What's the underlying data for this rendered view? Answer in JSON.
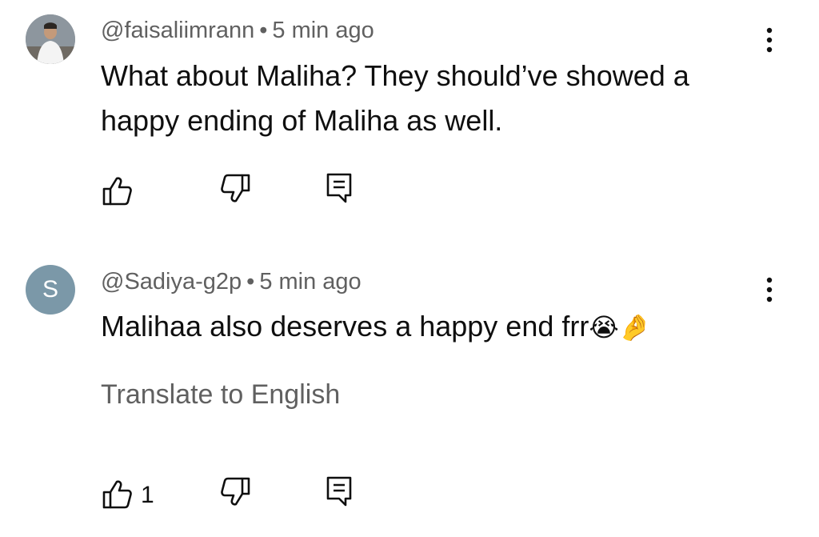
{
  "comments": [
    {
      "handle": "@faisaliimrann",
      "separator": "•",
      "time": "5 min ago",
      "text": "What about Maliha? They should’ve showed a happy ending of Maliha as well.",
      "avatar_type": "photo",
      "like_count": ""
    },
    {
      "handle": "@Sadiya-g2p",
      "separator": "•",
      "time": "5 min ago",
      "text": "Malihaa also deserves a happy end frr",
      "emojis": "😭🤌",
      "avatar_letter": "S",
      "avatar_color": "#7b98a8",
      "translate_label": "Translate to English",
      "like_count": "1"
    }
  ],
  "icons": {
    "like": "thumbs-up-icon",
    "dislike": "thumbs-down-icon",
    "reply": "reply-icon",
    "more": "more-vertical-icon"
  }
}
